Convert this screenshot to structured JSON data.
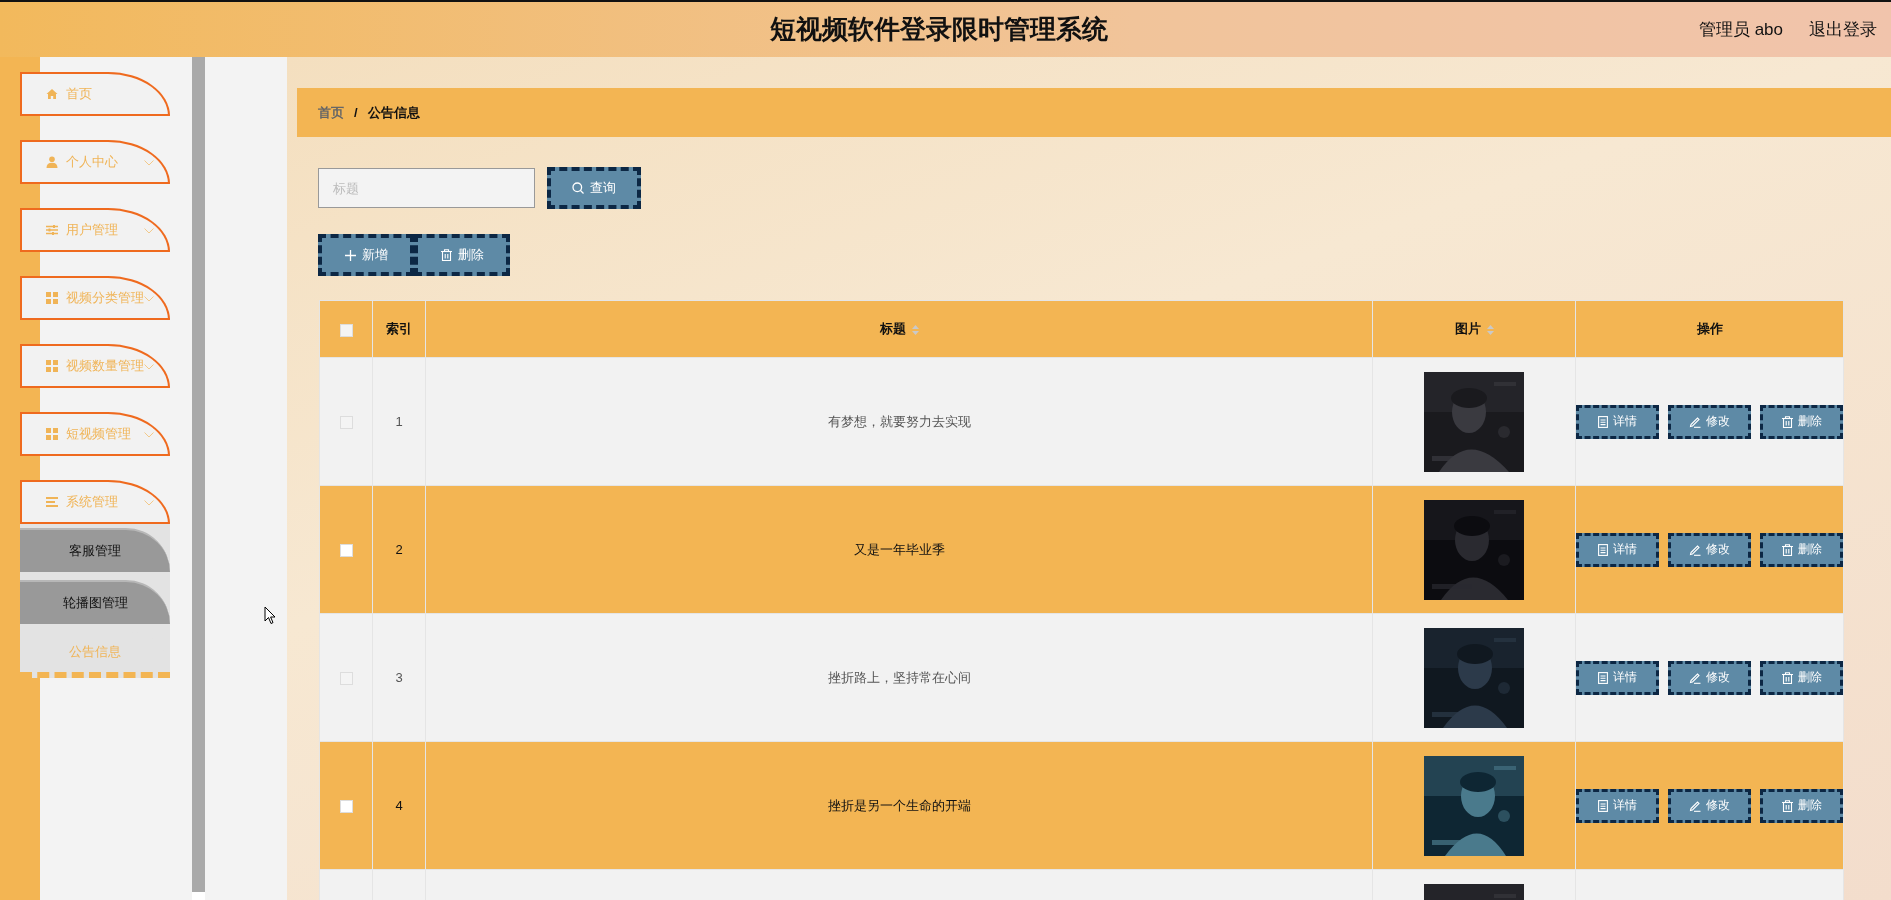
{
  "header": {
    "title": "短视频软件登录限时管理系统",
    "user": "管理员 abo",
    "logout": "退出登录"
  },
  "sidebar": {
    "items": [
      {
        "label": "首页"
      },
      {
        "label": "个人中心",
        "expandable": true
      },
      {
        "label": "用户管理",
        "expandable": true
      },
      {
        "label": "视频分类管理",
        "expandable": true
      },
      {
        "label": "视频数量管理",
        "expandable": true
      },
      {
        "label": "短视频管理",
        "expandable": true
      },
      {
        "label": "系统管理",
        "expandable": true,
        "expanded": true,
        "children": [
          {
            "label": "客服管理",
            "selected": false
          },
          {
            "label": "轮播图管理",
            "selected": false
          },
          {
            "label": "公告信息",
            "selected": true
          }
        ]
      }
    ]
  },
  "breadcrumb": {
    "separator": "/",
    "items": [
      {
        "label": "首页"
      },
      {
        "label": "公告信息"
      }
    ]
  },
  "search": {
    "placeholder": "标题",
    "button": "查询"
  },
  "actions": [
    {
      "label": "新增",
      "kind": "add"
    },
    {
      "label": "删除",
      "kind": "delete"
    }
  ],
  "table": {
    "columns": [
      {
        "kind": "check",
        "checked": false
      },
      {
        "label": "索引",
        "kind": "index"
      },
      {
        "label": "标题",
        "kind": "text",
        "sortable": true
      },
      {
        "label": "图片",
        "sortable": true
      },
      {
        "label": "操作",
        "kind": "ops"
      }
    ],
    "rows": [
      {
        "checked": false,
        "index": "1",
        "title": "有梦想，就要努力去实现",
        "picture": {
          "kind": "picture"
        },
        "ops": [
          {
            "label": "详情",
            "kind": "detail"
          },
          {
            "label": "修改",
            "kind": "edit"
          },
          {
            "label": "删除",
            "kind": "delete"
          }
        ]
      },
      {
        "checked": false,
        "index": "2",
        "title": "又是一年毕业季",
        "picture": {
          "kind": "picture"
        },
        "ops": [
          {
            "label": "详情",
            "kind": "detail"
          },
          {
            "label": "修改",
            "kind": "edit"
          },
          {
            "label": "删除",
            "kind": "delete"
          }
        ]
      },
      {
        "checked": false,
        "index": "3",
        "title": "挫折路上，坚持常在心间",
        "picture": {
          "kind": "picture"
        },
        "ops": [
          {
            "label": "详情",
            "kind": "detail"
          },
          {
            "label": "修改",
            "kind": "edit"
          },
          {
            "label": "删除",
            "kind": "delete"
          }
        ]
      },
      {
        "checked": false,
        "index": "4",
        "title": "挫折是另一个生命的开端",
        "picture": {
          "kind": "picture"
        },
        "ops": [
          {
            "label": "详情",
            "kind": "detail"
          },
          {
            "label": "修改",
            "kind": "edit"
          },
          {
            "label": "删除",
            "kind": "delete"
          }
        ]
      },
      {
        "picture": {
          "kind": "picture"
        }
      }
    ]
  }
}
